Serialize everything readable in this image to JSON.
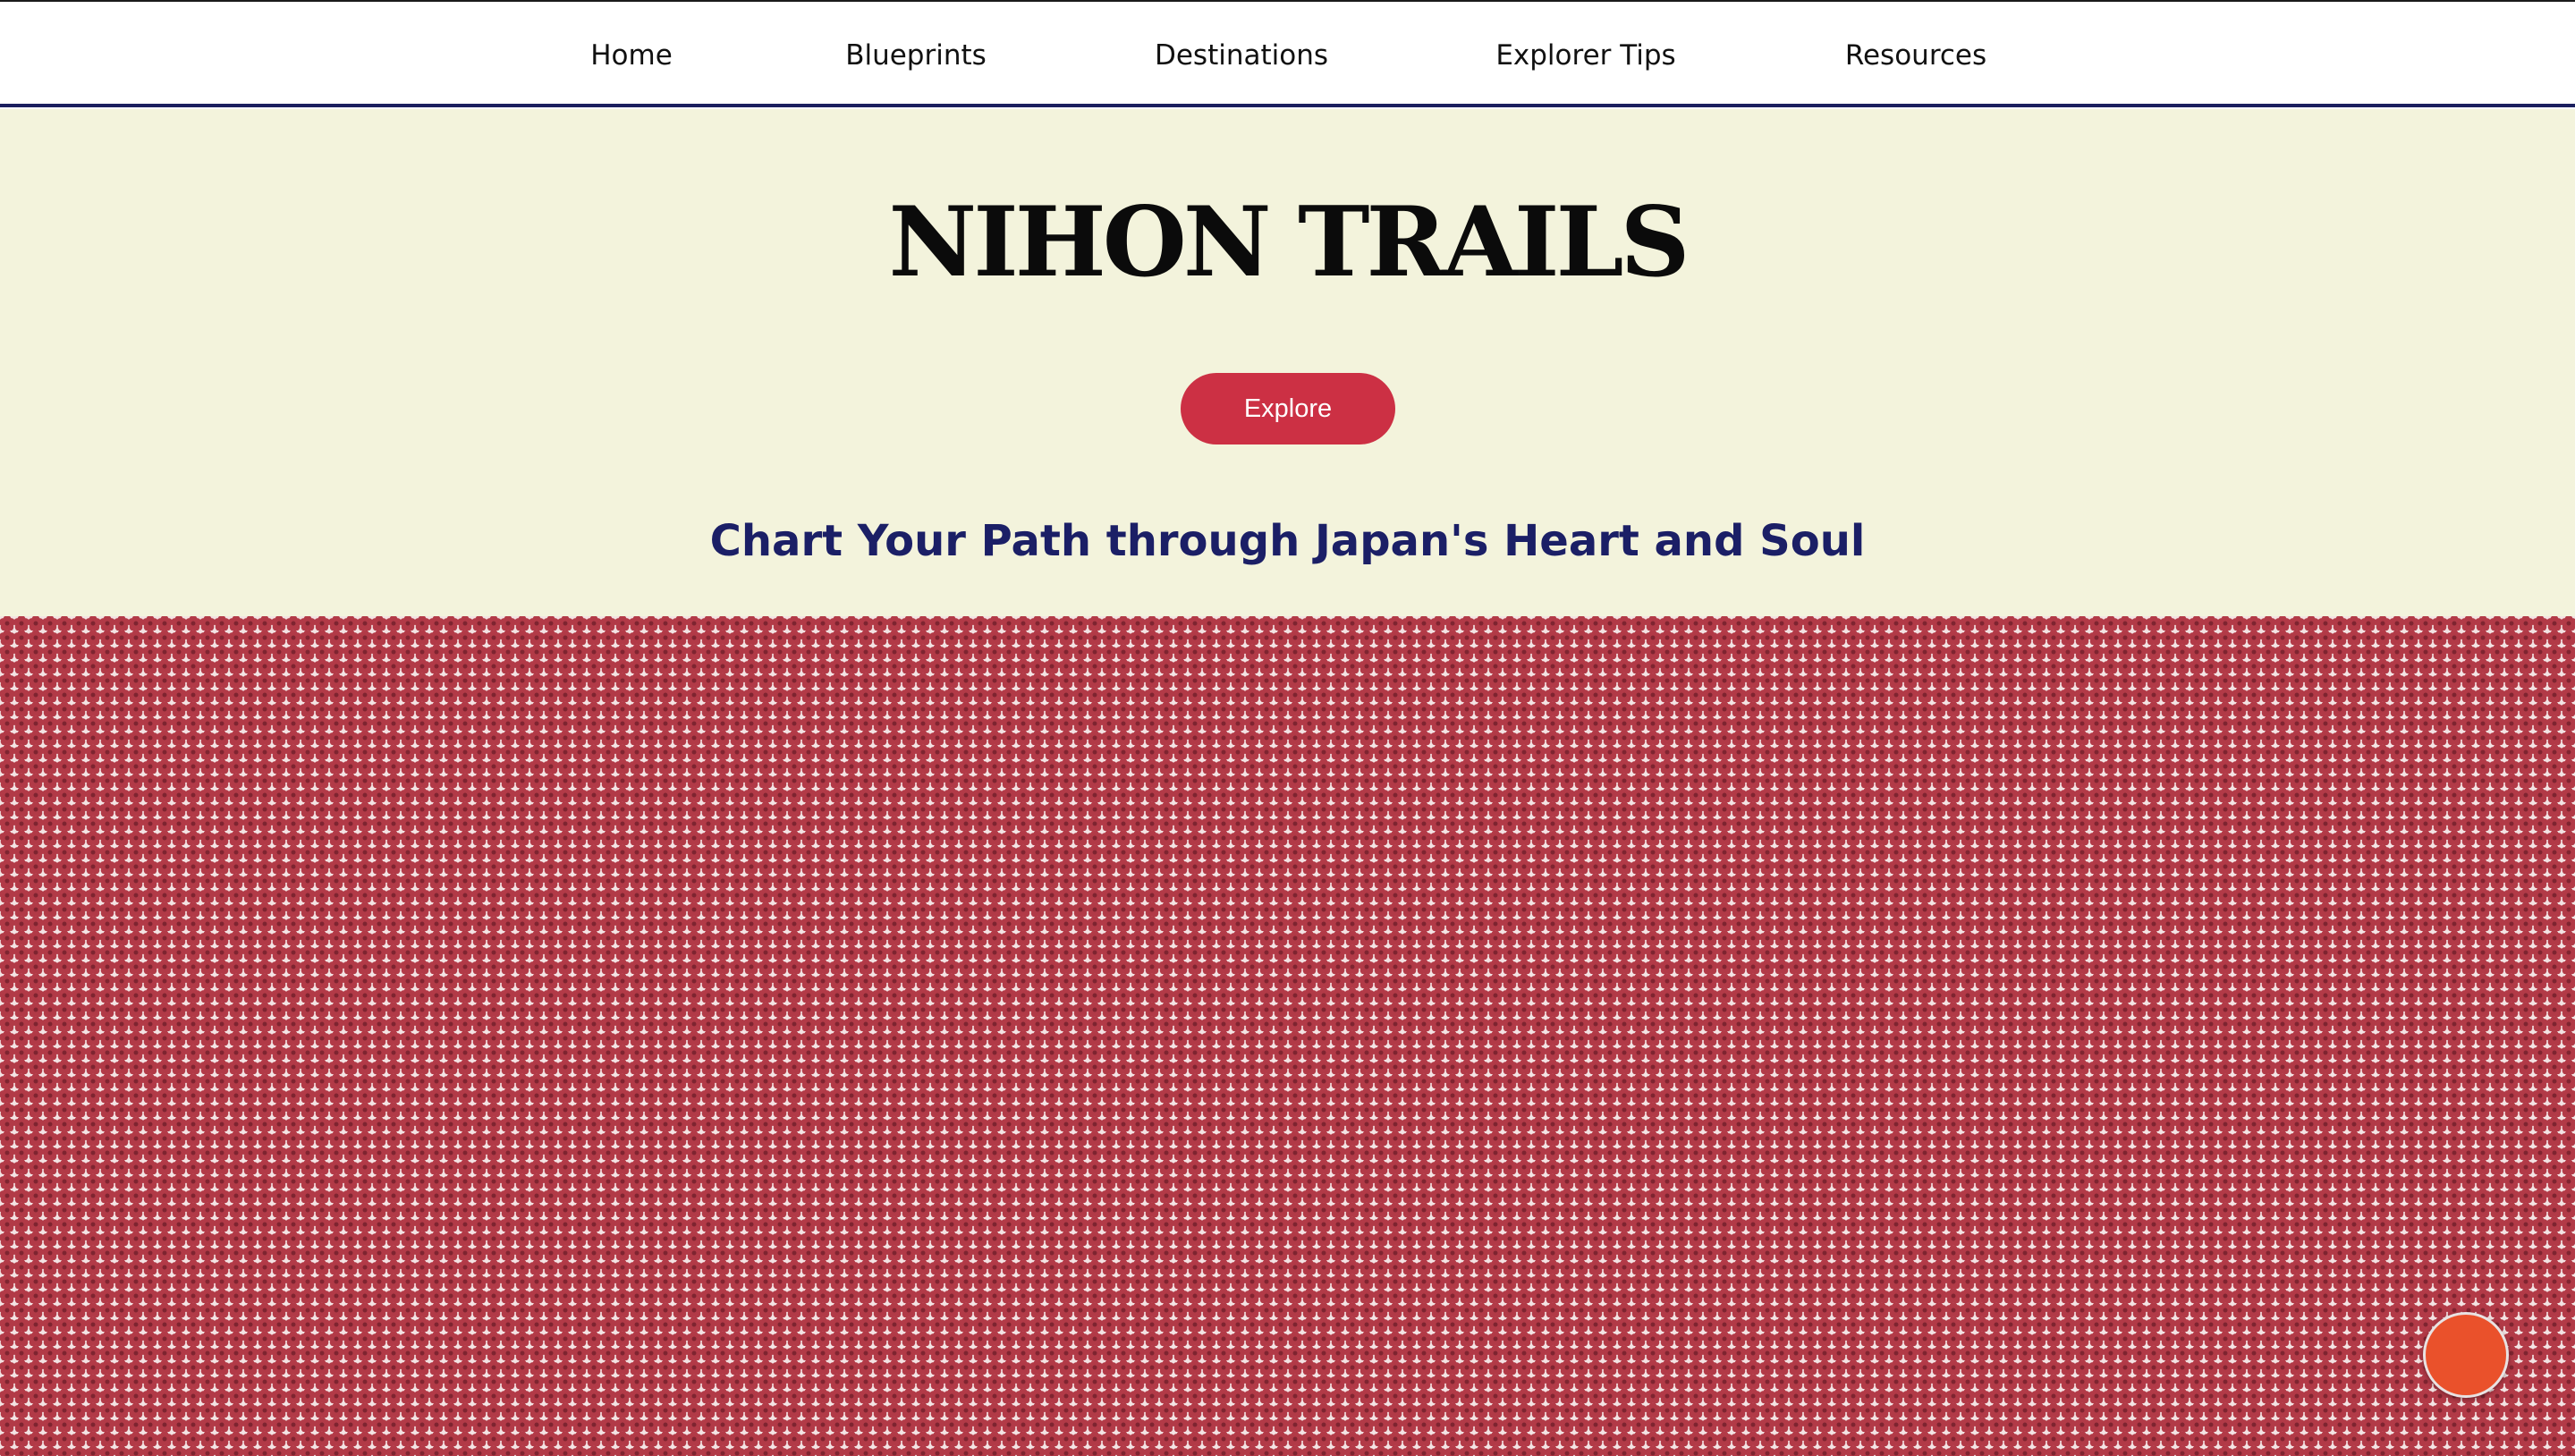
{
  "nav": {
    "items": [
      {
        "label": "Home"
      },
      {
        "label": "Blueprints"
      },
      {
        "label": "Destinations"
      },
      {
        "label": "Explorer Tips"
      },
      {
        "label": "Resources"
      }
    ]
  },
  "hero": {
    "title": "NIHON TRAILS",
    "cta_label": "Explore",
    "tagline": "Chart Your Path through Japan's Heart and Soul"
  },
  "pattern": {
    "motif": "plum-blossom-icon"
  },
  "fab": {
    "icon": "circle-button-icon"
  },
  "colors": {
    "nav_border": "#1b1f5e",
    "hero_background": "#f3f3dc",
    "cta_background": "#cc3044",
    "tagline": "#1b1f66",
    "pattern_flower": "#b23a47",
    "fab": "#ea512b"
  }
}
